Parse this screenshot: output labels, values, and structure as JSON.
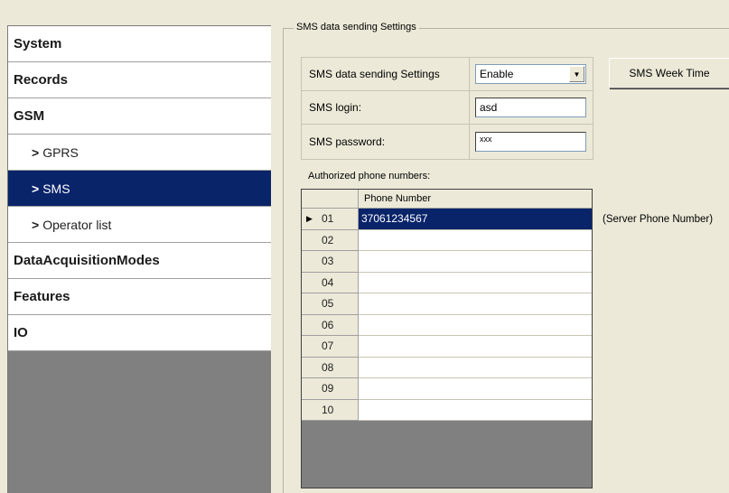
{
  "sidebar": {
    "items": [
      {
        "label": "System",
        "level": 0,
        "selected": false
      },
      {
        "label": "Records",
        "level": 0,
        "selected": false
      },
      {
        "label": "GSM",
        "level": 0,
        "selected": false
      },
      {
        "label": "GPRS",
        "level": 1,
        "selected": false
      },
      {
        "label": "SMS",
        "level": 1,
        "selected": true
      },
      {
        "label": "Operator list",
        "level": 1,
        "selected": false
      },
      {
        "label": "DataAcquisitionModes",
        "level": 0,
        "selected": false
      },
      {
        "label": "Features",
        "level": 0,
        "selected": false
      },
      {
        "label": "IO",
        "level": 0,
        "selected": false
      }
    ],
    "sub_prefix": ">"
  },
  "group": {
    "title": "SMS data sending Settings"
  },
  "form": {
    "sending_label": "SMS data sending Settings",
    "sending_value": "Enable",
    "login_label": "SMS login:",
    "login_value": "asd",
    "password_label": "SMS password:",
    "password_value": "xxx"
  },
  "week_time_button": "SMS Week Time",
  "authorized": {
    "label": "Authorized phone numbers:",
    "column_header": "Phone Number",
    "rows": [
      {
        "index": "01",
        "number": "37061234567",
        "selected": true
      },
      {
        "index": "02",
        "number": ""
      },
      {
        "index": "03",
        "number": ""
      },
      {
        "index": "04",
        "number": ""
      },
      {
        "index": "05",
        "number": ""
      },
      {
        "index": "06",
        "number": ""
      },
      {
        "index": "07",
        "number": ""
      },
      {
        "index": "08",
        "number": ""
      },
      {
        "index": "09",
        "number": ""
      },
      {
        "index": "10",
        "number": ""
      }
    ],
    "server_note": "(Server Phone Number)"
  },
  "colors": {
    "selection": "#0a246a",
    "window": "#ece9d8",
    "sidebar_empty": "#808080"
  }
}
